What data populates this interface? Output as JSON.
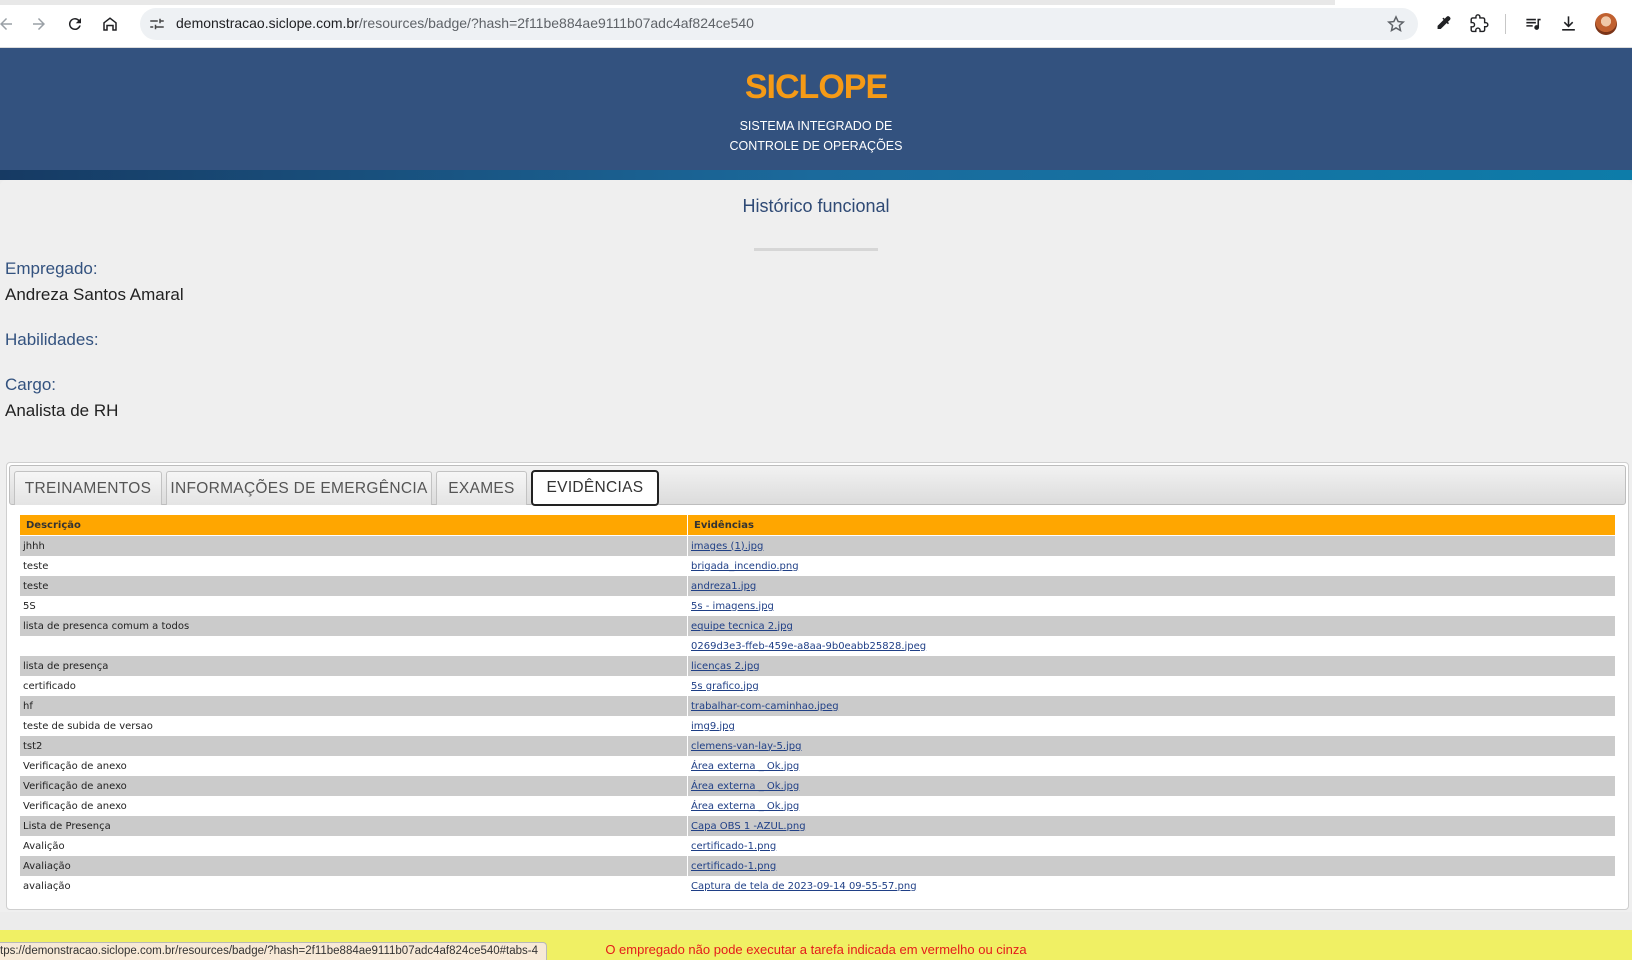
{
  "browser": {
    "url_host": "demonstracao.siclope.com.br",
    "url_path": "/resources/badge/?hash=2f11be884ae9111b07adc4af824ce540",
    "status_url": "tps://demonstracao.siclope.com.br/resources/badge/?hash=2f11be884ae9111b07adc4af824ce540#tabs-4",
    "icons": [
      "back-icon",
      "forward-icon",
      "reload-icon",
      "home-icon",
      "site-info-icon",
      "bookmark-star-icon",
      "eyedropper-icon",
      "extensions-icon",
      "reading-list-icon",
      "download-icon",
      "profile-avatar"
    ]
  },
  "header": {
    "brand": "SICLOPE",
    "subtitle_line1": "SISTEMA INTEGRADO DE",
    "subtitle_line2": "CONTROLE DE OPERAÇÕES",
    "brand_color": "#f59a16",
    "bg_color": "#33527f"
  },
  "page": {
    "title": "Histórico funcional",
    "employee_label": "Empregado:",
    "employee_value": "Andreza Santos Amaral",
    "skills_label": "Habilidades:",
    "role_label": "Cargo:",
    "role_value": "Analista de RH"
  },
  "tabs": [
    {
      "label": "TREINAMENTOS",
      "active": false
    },
    {
      "label": "INFORMAÇÕES DE EMERGÊNCIA",
      "active": false
    },
    {
      "label": "EXAMES",
      "active": false
    },
    {
      "label": "EVIDÊNCIAS",
      "active": true
    }
  ],
  "table": {
    "headers": [
      "Descrição",
      "Evidências"
    ],
    "header_color": "#ffa600",
    "rows": [
      {
        "desc": "jhhh",
        "file": "images (1).jpg"
      },
      {
        "desc": "teste",
        "file": "brigada_incendio.png"
      },
      {
        "desc": "teste",
        "file": "andreza1.jpg"
      },
      {
        "desc": "5S",
        "file": "5s - imagens.jpg"
      },
      {
        "desc": "lista de presenca comum a todos",
        "file": "equipe tecnica 2.jpg"
      },
      {
        "desc": "",
        "file": "0269d3e3-ffeb-459e-a8aa-9b0eabb25828.jpeg"
      },
      {
        "desc": "lista de presença",
        "file": "licenças 2.jpg"
      },
      {
        "desc": "certificado",
        "file": "5s grafico.jpg"
      },
      {
        "desc": "hf",
        "file": "trabalhar-com-caminhao.jpeg"
      },
      {
        "desc": "teste de subida de versao",
        "file": "img9.jpg"
      },
      {
        "desc": "tst2",
        "file": "clemens-van-lay-5.jpg"
      },
      {
        "desc": "Verificação de anexo",
        "file": "Área externa _ Ok.jpg"
      },
      {
        "desc": "Verificação de anexo",
        "file": "Área externa _ Ok.jpg"
      },
      {
        "desc": "Verificação de anexo",
        "file": "Área externa _ Ok.jpg"
      },
      {
        "desc": "Lista de Presença",
        "file": "Capa OBS 1 -AZUL.png"
      },
      {
        "desc": "Avalição",
        "file": "certificado-1.png"
      },
      {
        "desc": "Avaliação",
        "file": "certificado-1.png"
      },
      {
        "desc": "avaliação",
        "file": "Captura de tela de 2023-09-14 09-55-57.png"
      }
    ]
  },
  "footer": {
    "warning": "O empregado não pode executar a tarefa indicada em vermelho ou cinza",
    "warning_color": "#e41b1b",
    "bar_color": "#f0f064"
  }
}
